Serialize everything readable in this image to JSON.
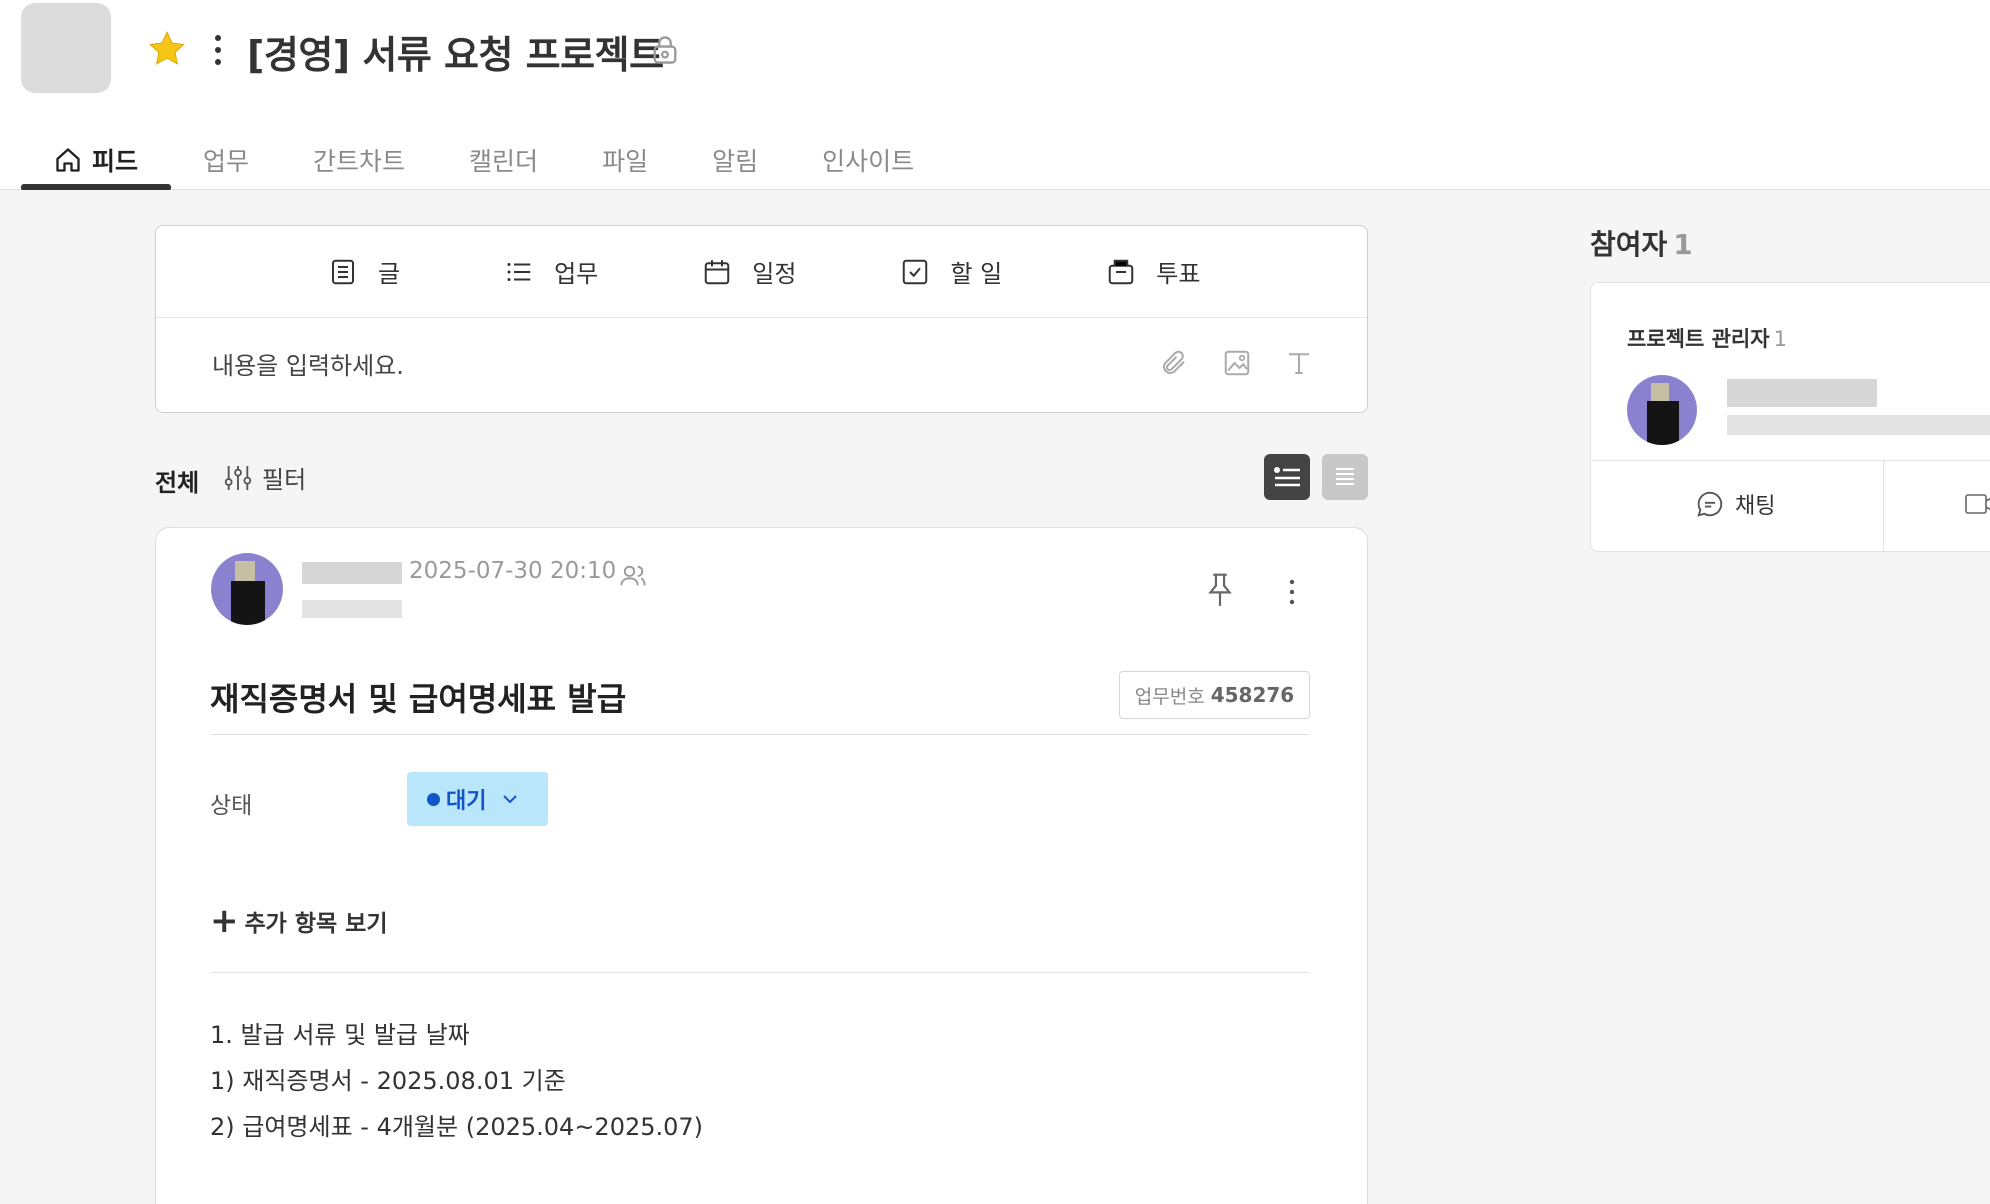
{
  "header": {
    "project_title": "[경영] 서류 요청 프로젝트"
  },
  "tabs": [
    {
      "label": "피드",
      "active": true
    },
    {
      "label": "업무"
    },
    {
      "label": "간트차트"
    },
    {
      "label": "캘린더"
    },
    {
      "label": "파일"
    },
    {
      "label": "알림"
    },
    {
      "label": "인사이트"
    }
  ],
  "composer": {
    "types": [
      "글",
      "업무",
      "일정",
      "할 일",
      "투표"
    ],
    "placeholder": "내용을 입력하세요."
  },
  "filter": {
    "label": "전체",
    "button": "필터"
  },
  "post": {
    "date": "2025-07-30 20:10",
    "title": "재직증명서 및 급여명세표 발급",
    "task_no_label": "업무번호",
    "task_no": "458276",
    "status_label": "상태",
    "status_value": "대기",
    "more_items": "추가 항목 보기",
    "content": [
      "1. 발급 서류 및 발급 날짜",
      "1) 재직증명서 - 2025.08.01 기준",
      "2) 급여명세표 - 4개월분 (2025.04~2025.07)"
    ]
  },
  "participants": {
    "title": "참여자",
    "count": "1",
    "role": "프로젝트 관리자",
    "role_count": "1",
    "chat_button": "채팅"
  },
  "colors": {
    "status_bg": "#b9e6fb",
    "status_text": "#1255c9",
    "star": "#f5c518",
    "avatar": "#8b82cf"
  }
}
